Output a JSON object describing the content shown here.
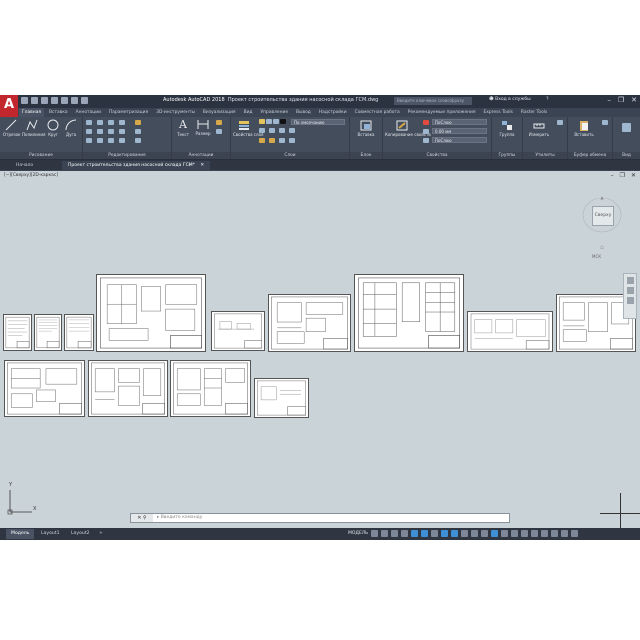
{
  "app": {
    "logo": "A",
    "title_app": "Autodesk AutoCAD 2018",
    "title_file": "Проект строительства здания насосной склада ГСМ.dwg",
    "search_placeholder": "Введите ключевое слово/фразу",
    "user": "Вход в службы",
    "help": "?"
  },
  "ribbon_tabs": [
    "Главная",
    "Вставка",
    "Аннотации",
    "Параметризация",
    "3D-инструменты",
    "Визуализация",
    "Вид",
    "Управление",
    "Вывод",
    "Надстройки",
    "Совместная работа",
    "Рекомендуемые приложения",
    "Express Tools",
    "Raster Tools"
  ],
  "ribbon": {
    "draw": {
      "title": "Рисование",
      "tools": [
        "Отрезок",
        "Полилиния",
        "Круг",
        "Дуга"
      ]
    },
    "modify": {
      "title": "Редактирование"
    },
    "annotation": {
      "title": "Аннотации",
      "tools": [
        "Текст",
        "Размер"
      ]
    },
    "layers": {
      "title": "Слои",
      "layer_props": "Свойства слоя",
      "layer_combo": "По умолчанию"
    },
    "block": {
      "title": "Блок",
      "tools": [
        "Вставка"
      ]
    },
    "properties": {
      "title": "Свойства",
      "match": "Копирование свойств",
      "color": "ПоСлою",
      "lineweight": "0.00 мм",
      "linetype": "ПоСлою"
    },
    "groups": {
      "title": "Группы",
      "tools": [
        "Группа"
      ]
    },
    "utilities": {
      "title": "Утилиты",
      "tools": [
        "Измерить"
      ]
    },
    "clipboard": {
      "title": "Буфер обмена",
      "tools": [
        "Вставить"
      ]
    },
    "view": {
      "title": "Вид"
    }
  },
  "file_tabs": [
    "Начало",
    "Проект строительства здания насосной склада ГСМ*"
  ],
  "viewport": {
    "label": "[−][Сверху][2D-каркас]",
    "viewcube": "Сверху",
    "wcs": "МСК",
    "command_prompt": "Введите команду",
    "ucs_y": "Y",
    "ucs_x": "X"
  },
  "layout_tabs": [
    "Модель",
    "Layout1",
    "Layout2"
  ],
  "status": {
    "model": "МОДЕЛЬ"
  }
}
